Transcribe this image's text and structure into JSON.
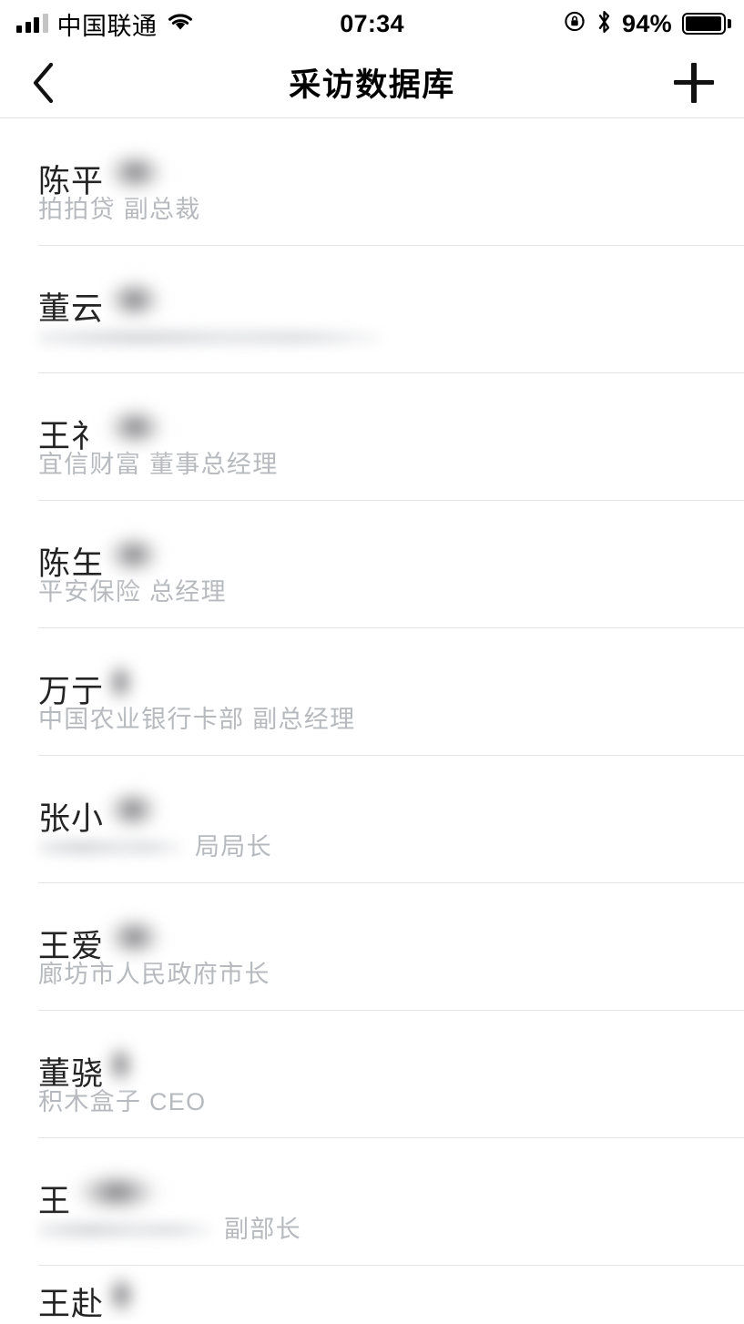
{
  "status_bar": {
    "carrier": "中国联通",
    "time": "07:34",
    "battery_percent": "94%",
    "signal_bars_filled": 3,
    "signal_bars_total": 4,
    "icons": [
      "signal-bars-icon",
      "wifi-icon",
      "rotation-lock-icon",
      "bluetooth-icon",
      "battery-icon"
    ]
  },
  "nav_bar": {
    "title": "采访数据库",
    "back_icon": "chevron-left-icon",
    "add_icon": "plus-icon"
  },
  "list": {
    "items": [
      {
        "name_visible": "陈平",
        "name_redacted": true,
        "name_blur_width": 72,
        "org": "拍拍贷",
        "title": "副总裁",
        "subtitle": "拍拍贷  副总裁",
        "subtitle_redacted": false,
        "subtitle_blur_width": 0
      },
      {
        "name_visible": "董云",
        "name_redacted": true,
        "name_blur_width": 70,
        "org": "",
        "title": "",
        "subtitle": "",
        "subtitle_redacted": true,
        "subtitle_blur_width": 375
      },
      {
        "name_visible": "王礻",
        "name_redacted": true,
        "name_blur_width": 72,
        "org": "宜信财富",
        "title": "董事总经理",
        "subtitle": "宜信财富  董事总经理",
        "subtitle_redacted": false,
        "subtitle_blur_width": 0
      },
      {
        "name_visible": "陈玍",
        "name_redacted": true,
        "name_blur_width": 68,
        "org": "平安保险",
        "title": "总经理",
        "subtitle": "平安保险  总经理",
        "subtitle_redacted": false,
        "subtitle_blur_width": 0
      },
      {
        "name_visible": "万亍",
        "name_redacted": true,
        "name_blur_width": 38,
        "org": "中国农业银行卡部",
        "title": "副总经理",
        "subtitle": "中国农业银行卡部  副总经理",
        "subtitle_redacted": false,
        "subtitle_blur_width": 0
      },
      {
        "name_visible": "张小",
        "name_redacted": true,
        "name_blur_width": 66,
        "org": "",
        "title": "局局长",
        "subtitle": "局局长",
        "subtitle_redacted": true,
        "subtitle_blur_width": 158
      },
      {
        "name_visible": "王爱",
        "name_redacted": true,
        "name_blur_width": 70,
        "org": "廊坊市人民政府",
        "title": "市长",
        "subtitle": "廊坊市人民政府市长",
        "subtitle_redacted": false,
        "subtitle_blur_width": 0
      },
      {
        "name_visible": "董骁",
        "name_redacted": true,
        "name_blur_width": 38,
        "org": "积木盒子",
        "title": "CEO",
        "subtitle": "积木盒子  CEO",
        "subtitle_redacted": false,
        "subtitle_blur_width": 0
      },
      {
        "name_visible": "王",
        "name_redacted": true,
        "name_blur_width": 105,
        "org": "",
        "title": "副部长",
        "subtitle": "副部长",
        "subtitle_redacted": true,
        "subtitle_blur_width": 190
      },
      {
        "name_visible": "王赴",
        "name_redacted": true,
        "name_blur_width": 40,
        "org": "",
        "title": "",
        "subtitle": "",
        "subtitle_redacted": false,
        "subtitle_blur_width": 0,
        "cropped": true
      }
    ]
  },
  "colors": {
    "background": "#ffffff",
    "name_text": "#232323",
    "subtitle_text": "#b6b9be",
    "divider": "#e4e4e4",
    "nav_border": "#e2e2e2",
    "status_icon": "#000000"
  }
}
